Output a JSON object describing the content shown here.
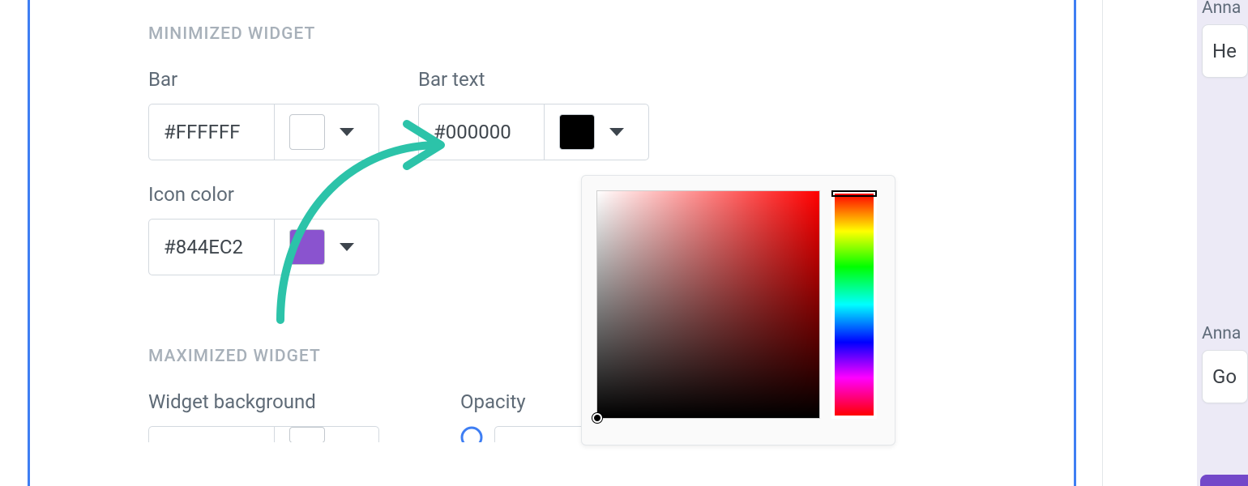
{
  "sections": {
    "minimized": {
      "title": "MINIMIZED WIDGET",
      "bar": {
        "label": "Bar",
        "value": "#FFFFFF",
        "swatch": "#FFFFFF"
      },
      "bar_text": {
        "label": "Bar text",
        "value": "#000000",
        "swatch": "#000000"
      },
      "icon_color": {
        "label": "Icon color",
        "value": "#844EC2",
        "swatch": "#8A53CF"
      }
    },
    "maximized": {
      "title": "MAXIMIZED WIDGET",
      "widget_bg": {
        "label": "Widget background"
      },
      "opacity": {
        "label": "Opacity"
      }
    }
  },
  "preview": {
    "msg1": {
      "author": "Anna",
      "text": "He"
    },
    "msg2": {
      "author": "Anna",
      "text": "Go"
    }
  },
  "colors": {
    "accent": "#3e7ef3",
    "arrow": "#2cc3a9",
    "hue_selected": "#ff0000"
  }
}
